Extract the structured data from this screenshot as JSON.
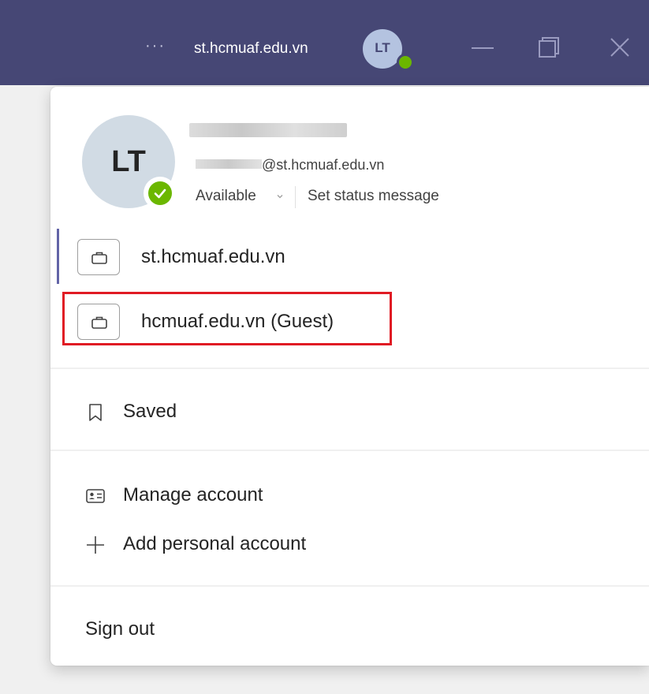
{
  "titlebar": {
    "more_label": "···",
    "org_name": "st.hcmuaf.edu.vn",
    "avatar_initials": "LT",
    "accent": "#464775"
  },
  "profile": {
    "initials": "LT",
    "email_suffix": "@st.hcmuaf.edu.vn",
    "status": "Available",
    "status_message_link": "Set status message",
    "status_color": "#6bb700"
  },
  "organizations": [
    {
      "label": "st.hcmuaf.edu.vn",
      "active": true,
      "icon": "briefcase-icon"
    },
    {
      "label": "hcmuaf.edu.vn (Guest)",
      "active": false,
      "highlighted": true,
      "icon": "briefcase-icon"
    }
  ],
  "menu": {
    "saved": {
      "label": "Saved",
      "icon": "bookmark-icon"
    },
    "manage_account": {
      "label": "Manage account",
      "icon": "contact-card-icon"
    },
    "add_personal_account": {
      "label": "Add personal account",
      "icon": "plus-icon"
    },
    "sign_out": {
      "label": "Sign out"
    }
  },
  "colors": {
    "highlight_border": "#e01b24",
    "active_indicator": "#6264a7"
  }
}
